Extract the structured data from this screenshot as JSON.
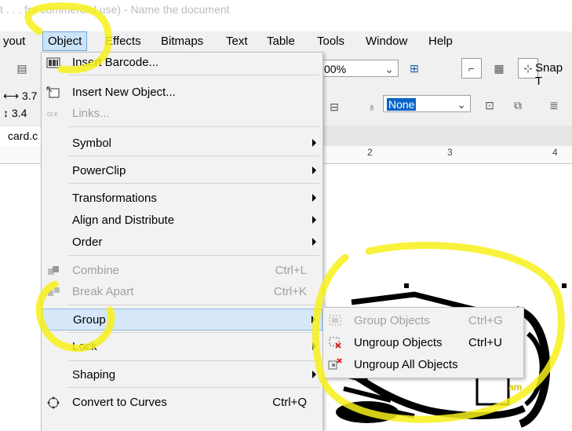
{
  "title_bar": {
    "text": "t . . . for commercial use) - Name the document"
  },
  "menubar": {
    "items": [
      {
        "label": "yout"
      },
      {
        "label": "Object"
      },
      {
        "label": "Effects"
      },
      {
        "label": "Bitmaps"
      },
      {
        "label": "Text"
      },
      {
        "label": "Table"
      },
      {
        "label": "Tools"
      },
      {
        "label": "Window"
      },
      {
        "label": "Help"
      }
    ]
  },
  "toolbar": {
    "zoom_value": "00%",
    "snap_label": "Snap T",
    "width_value": "3.7",
    "height_value": "3.4",
    "outline_value": "None"
  },
  "document_tab": {
    "label": "card.c"
  },
  "ruler": {
    "ticks": [
      "2",
      "3",
      "4"
    ]
  },
  "artwork": {
    "logo_text": "am"
  },
  "object_menu": {
    "insert_barcode": "Insert Barcode...",
    "insert_new_object": "Insert New Object...",
    "links": "Links...",
    "symbol": "Symbol",
    "powerclip": "PowerClip",
    "transformations": "Transformations",
    "align_distribute": "Align and Distribute",
    "order": "Order",
    "combine": "Combine",
    "combine_shortcut": "Ctrl+L",
    "break_apart": "Break Apart",
    "break_apart_shortcut": "Ctrl+K",
    "group": "Group",
    "lock": "Lock",
    "shaping": "Shaping",
    "convert_to_curves": "Convert to Curves",
    "convert_to_curves_shortcut": "Ctrl+Q"
  },
  "group_submenu": {
    "group_objects": "Group Objects",
    "group_objects_shortcut": "Ctrl+G",
    "ungroup_objects": "Ungroup Objects",
    "ungroup_objects_shortcut": "Ctrl+U",
    "ungroup_all": "Ungroup All Objects"
  },
  "colors": {
    "menu_highlight": "#d5e7f8",
    "active_menu": "#cce4f7",
    "annotation_yellow": "#f7f01a"
  }
}
